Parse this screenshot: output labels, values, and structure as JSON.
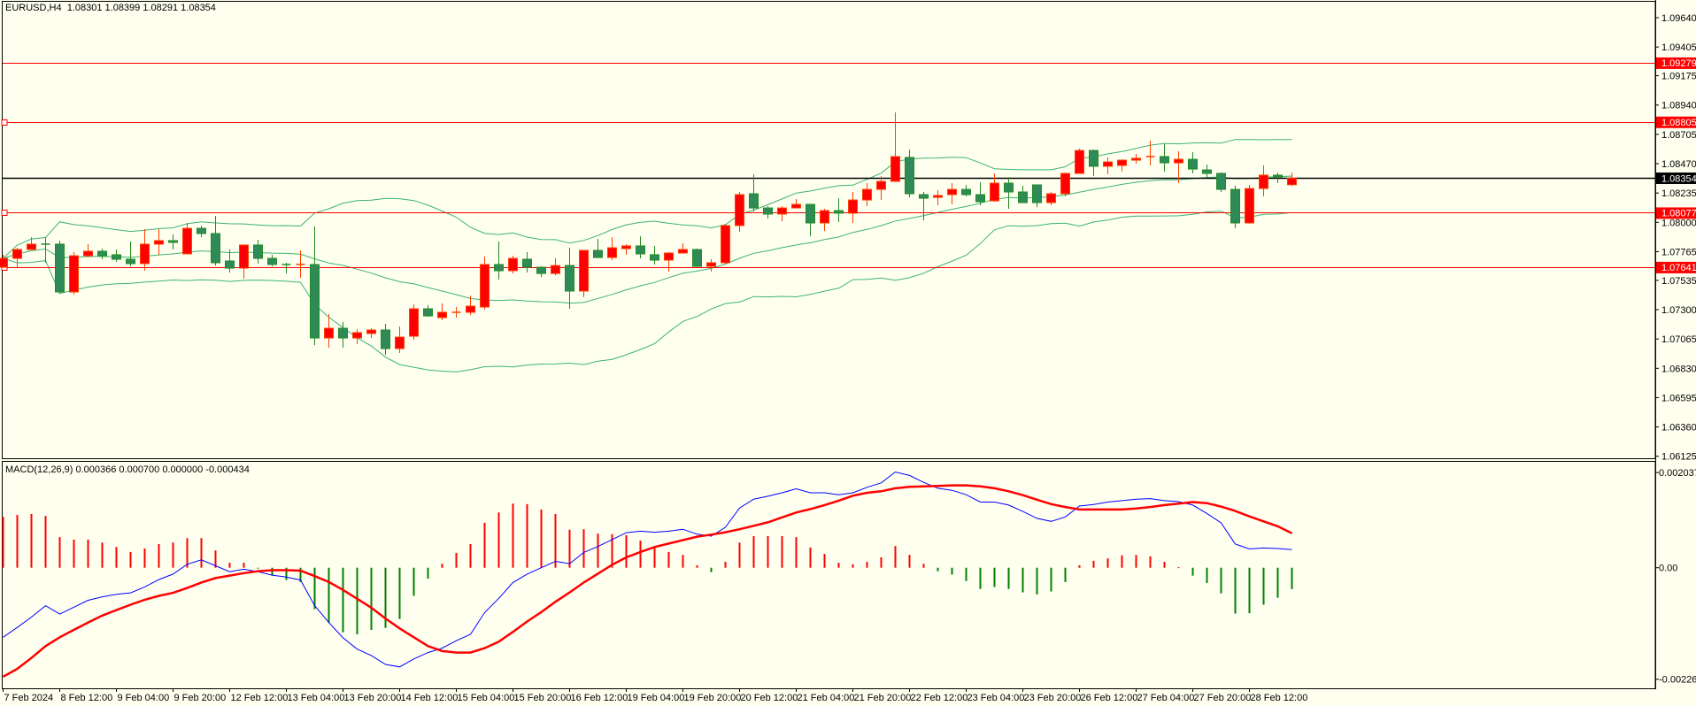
{
  "header": {
    "symbol": "EURUSD,H4",
    "ohlc": "1.08301 1.08399 1.08291 1.08354"
  },
  "macd_label": "MACD(12,26,9) 0.000366 0.000700 0.000000 -0.000434",
  "colors": {
    "background": "#fffff0",
    "bull_fill": "#ff0000",
    "bull_outline": "#ff4000",
    "bear_fill": "#2e8b57",
    "bear_outline": "#228b22",
    "bands": "#3cb371",
    "hline": "#ff0000",
    "current_price": "#000000",
    "macd_main": "#0000ff",
    "macd_signal": "#ff0000",
    "hist_up": "#ff0000",
    "hist_down": "#008000"
  },
  "time_axis": {
    "labels": [
      "7 Feb 2024",
      "8 Feb 12:00",
      "9 Feb 04:00",
      "9 Feb 20:00",
      "12 Feb 12:00",
      "13 Feb 04:00",
      "13 Feb 20:00",
      "14 Feb 12:00",
      "15 Feb 04:00",
      "15 Feb 20:00",
      "16 Feb 12:00",
      "19 Feb 04:00",
      "19 Feb 20:00",
      "20 Feb 12:00",
      "21 Feb 04:00",
      "21 Feb 20:00",
      "22 Feb 12:00",
      "23 Feb 04:00",
      "23 Feb 20:00",
      "26 Feb 12:00",
      "27 Feb 04:00",
      "27 Feb 20:00",
      "28 Feb 12:00"
    ]
  },
  "chart_data": [
    {
      "type": "candlestick",
      "symbol": "EURUSD",
      "timeframe": "H4",
      "ylim": [
        1.06125,
        1.0964
      ],
      "price_axis": {
        "ticks": [
          "1.09640",
          "1.09405",
          "1.09175",
          "1.08940",
          "1.08705",
          "1.08470",
          "1.08235",
          "1.08000",
          "1.07765",
          "1.07535",
          "1.07300",
          "1.07065",
          "1.06830",
          "1.06595",
          "1.06360",
          "1.06125"
        ]
      },
      "hlines": [
        {
          "label": "1.09279",
          "handle": false
        },
        {
          "label": "1.08805",
          "handle": true
        },
        {
          "label": "1.08077",
          "handle": true
        },
        {
          "label": "1.07641",
          "handle": true
        }
      ],
      "current_price": "1.08354",
      "indicator": "Bollinger Bands",
      "candles_ohlc": [
        [
          1.0764,
          1.0774,
          1.0764,
          1.07711
        ],
        [
          1.07711,
          1.07796,
          1.0764,
          1.07782
        ],
        [
          1.07782,
          1.07881,
          1.07782,
          1.07825
        ],
        [
          1.07825,
          1.07881,
          1.07676,
          1.07824
        ],
        [
          1.07825,
          1.07853,
          1.07428,
          1.07442
        ],
        [
          1.07442,
          1.07761,
          1.0742,
          1.07732
        ],
        [
          1.07732,
          1.07825,
          1.07718,
          1.07768
        ],
        [
          1.07768,
          1.07789,
          1.07704,
          1.07732
        ],
        [
          1.0774,
          1.07782,
          1.07683,
          1.07704
        ],
        [
          1.07704,
          1.07846,
          1.07647,
          1.07669
        ],
        [
          1.07669,
          1.07945,
          1.07612,
          1.07825
        ],
        [
          1.07825,
          1.07945,
          1.0774,
          1.07853
        ],
        [
          1.07853,
          1.07903,
          1.07782,
          1.07839
        ],
        [
          1.07747,
          1.07995,
          1.07747,
          1.07952
        ],
        [
          1.07952,
          1.07974,
          1.07881,
          1.0791
        ],
        [
          1.0791,
          1.08052,
          1.07654,
          1.07676
        ],
        [
          1.0769,
          1.07782,
          1.07598,
          1.07633
        ],
        [
          1.07633,
          1.07818,
          1.07548,
          1.07818
        ],
        [
          1.07818,
          1.0786,
          1.07669,
          1.07711
        ],
        [
          1.07711,
          1.0774,
          1.07647,
          1.07662
        ],
        [
          1.07662,
          1.07676,
          1.0759,
          1.0766
        ],
        [
          1.07662,
          1.07775,
          1.07555,
          1.07663
        ],
        [
          1.07662,
          1.07967,
          1.07016,
          1.07073
        ],
        [
          1.07073,
          1.07265,
          1.06995,
          1.07151
        ],
        [
          1.07151,
          1.07201,
          1.06995,
          1.07073
        ],
        [
          1.07073,
          1.07144,
          1.07023,
          1.07116
        ],
        [
          1.07109,
          1.07151,
          1.07073,
          1.07137
        ],
        [
          1.07137,
          1.07187,
          1.06938,
          1.06988
        ],
        [
          1.06988,
          1.07165,
          1.06953,
          1.0708
        ],
        [
          1.07087,
          1.07343,
          1.07059,
          1.07307
        ],
        [
          1.07307,
          1.07336,
          1.07243,
          1.0725
        ],
        [
          1.07236,
          1.0735,
          1.07215,
          1.07279
        ],
        [
          1.07279,
          1.07321,
          1.07236,
          1.07279
        ],
        [
          1.07279,
          1.07413,
          1.07257,
          1.07328
        ],
        [
          1.07321,
          1.07725,
          1.073,
          1.07662
        ],
        [
          1.07662,
          1.07846,
          1.07541,
          1.07612
        ],
        [
          1.07612,
          1.07732,
          1.0759,
          1.07711
        ],
        [
          1.07704,
          1.07761,
          1.07598,
          1.0764
        ],
        [
          1.0764,
          1.07647,
          1.07562,
          1.0759
        ],
        [
          1.0759,
          1.07711,
          1.07576,
          1.07654
        ],
        [
          1.07654,
          1.07796,
          1.07307,
          1.07449
        ],
        [
          1.07449,
          1.07775,
          1.07399,
          1.07775
        ],
        [
          1.07775,
          1.07867,
          1.07718,
          1.07718
        ],
        [
          1.07718,
          1.07881,
          1.07697,
          1.07796
        ],
        [
          1.07789,
          1.07825,
          1.0774,
          1.07811
        ],
        [
          1.07811,
          1.07888,
          1.07711,
          1.07747
        ],
        [
          1.0774,
          1.07811,
          1.07662,
          1.07697
        ],
        [
          1.07697,
          1.07761,
          1.07605,
          1.07754
        ],
        [
          1.07754,
          1.07832,
          1.07754,
          1.07782
        ],
        [
          1.07782,
          1.07789,
          1.0764,
          1.07647
        ],
        [
          1.07647,
          1.07704,
          1.07605,
          1.07676
        ],
        [
          1.07676,
          1.07988,
          1.07669,
          1.07974
        ],
        [
          1.07974,
          1.08243,
          1.07924,
          1.08222
        ],
        [
          1.08229,
          1.08385,
          1.08087,
          1.08115
        ],
        [
          1.08115,
          1.0813,
          1.0803,
          1.08066
        ],
        [
          1.08066,
          1.0813,
          1.08009,
          1.08115
        ],
        [
          1.08115,
          1.08186,
          1.08115,
          1.08144
        ],
        [
          1.08144,
          1.08144,
          1.07888,
          1.07995
        ],
        [
          1.07995,
          1.08108,
          1.07931,
          1.08094
        ],
        [
          1.08094,
          1.08193,
          1.08002,
          1.08073
        ],
        [
          1.08073,
          1.08243,
          1.07995,
          1.08179
        ],
        [
          1.08179,
          1.08314,
          1.0813,
          1.08264
        ],
        [
          1.08264,
          1.0837,
          1.08179,
          1.08328
        ],
        [
          1.08328,
          1.08881,
          1.08328,
          1.08527
        ],
        [
          1.0852,
          1.08583,
          1.082,
          1.08229
        ],
        [
          1.08222,
          1.08243,
          1.08016,
          1.08193
        ],
        [
          1.082,
          1.08257,
          1.08137,
          1.08215
        ],
        [
          1.08222,
          1.08314,
          1.08144,
          1.08264
        ],
        [
          1.08264,
          1.083,
          1.08208,
          1.08222
        ],
        [
          1.08222,
          1.08321,
          1.08137,
          1.08165
        ],
        [
          1.08172,
          1.08392,
          1.08165,
          1.08314
        ],
        [
          1.08314,
          1.08363,
          1.08108,
          1.08243
        ],
        [
          1.08243,
          1.08293,
          1.08158,
          1.08158
        ],
        [
          1.083,
          1.083,
          1.08122,
          1.08158
        ],
        [
          1.08158,
          1.08243,
          1.08137,
          1.08229
        ],
        [
          1.08229,
          1.08399,
          1.08208,
          1.08392
        ],
        [
          1.08392,
          1.08591,
          1.08392,
          1.08576
        ],
        [
          1.08576,
          1.08583,
          1.0837,
          1.08449
        ],
        [
          1.08449,
          1.0852,
          1.08385,
          1.08484
        ],
        [
          1.08456,
          1.08505,
          1.08406,
          1.08498
        ],
        [
          1.08498,
          1.08548,
          1.0847,
          1.08513
        ],
        [
          1.0852,
          1.08654,
          1.08456,
          1.08527
        ],
        [
          1.08527,
          1.08626,
          1.08406,
          1.08477
        ],
        [
          1.08477,
          1.08569,
          1.08314,
          1.08505
        ],
        [
          1.08505,
          1.08562,
          1.08392,
          1.08427
        ],
        [
          1.0842,
          1.08463,
          1.08363,
          1.08392
        ],
        [
          1.08392,
          1.08399,
          1.08243,
          1.08264
        ],
        [
          1.08264,
          1.08293,
          1.07952,
          1.07995
        ],
        [
          1.07995,
          1.083,
          1.07988,
          1.08271
        ],
        [
          1.08271,
          1.08456,
          1.08208,
          1.08378
        ],
        [
          1.08378,
          1.08399,
          1.08314,
          1.08363
        ],
        [
          1.08301,
          1.08399,
          1.08291,
          1.08354
        ]
      ]
    },
    {
      "type": "line",
      "title": "MACD(12,26,9)",
      "ylim": [
        -0.00226,
        0.002037
      ],
      "axis_labels": [
        "0.002037",
        "0.00",
        "-0.00226"
      ],
      "main": [
        -0.00141,
        -0.00121,
        -0.001,
        -0.00077,
        -0.00094,
        -0.0008,
        -0.00066,
        -0.00059,
        -0.00054,
        -0.00051,
        -0.00039,
        -0.00024,
        -0.00013,
        7e-05,
        0.00016,
        4e-05,
        -8e-05,
        -3e-05,
        -8e-05,
        -0.00015,
        -0.00019,
        -0.00025,
        -0.00077,
        -0.00111,
        -0.00142,
        -0.00165,
        -0.00178,
        -0.00196,
        -0.00201,
        -0.00185,
        -0.00172,
        -0.00163,
        -0.00148,
        -0.00135,
        -0.00091,
        -0.00062,
        -0.0003,
        -0.00013,
        0.0,
        0.00013,
        8e-05,
        0.00031,
        0.00043,
        0.00057,
        0.00071,
        0.00074,
        0.00072,
        0.00074,
        0.00078,
        0.00068,
        0.00064,
        0.00082,
        0.00121,
        0.00139,
        0.00145,
        0.00152,
        0.0016,
        0.00152,
        0.00152,
        0.00148,
        0.00152,
        0.00163,
        0.00172,
        0.00194,
        0.00187,
        0.00173,
        0.00161,
        0.00157,
        0.00148,
        0.00133,
        0.00133,
        0.00127,
        0.00114,
        0.001,
        0.00094,
        0.00103,
        0.00125,
        0.00128,
        0.00133,
        0.00136,
        0.00139,
        0.0014,
        0.00136,
        0.00134,
        0.00127,
        0.0011,
        0.00091,
        0.00048,
        0.00038,
        0.0004,
        0.00039,
        0.000366
      ],
      "signal": [
        -0.00221,
        -0.00205,
        -0.00183,
        -0.00159,
        -0.00141,
        -0.00126,
        -0.00111,
        -0.00097,
        -0.00086,
        -0.00075,
        -0.00065,
        -0.00057,
        -0.00051,
        -0.00041,
        -0.0003,
        -0.00021,
        -0.00016,
        -0.00011,
        -7e-05,
        -5e-05,
        -5e-05,
        -6e-05,
        -0.00017,
        -0.00029,
        -0.00045,
        -0.00063,
        -0.00081,
        -0.00103,
        -0.00123,
        -0.00141,
        -0.00159,
        -0.00169,
        -0.00172,
        -0.00172,
        -0.00163,
        -0.0015,
        -0.0013,
        -0.00109,
        -0.0009,
        -0.00069,
        -0.0005,
        -0.0003,
        -0.00012,
        6e-05,
        0.00021,
        0.00032,
        0.00042,
        0.00049,
        0.00056,
        0.00063,
        0.00067,
        0.00072,
        0.00078,
        0.00085,
        0.00092,
        0.00102,
        0.00112,
        0.00119,
        0.00127,
        0.00136,
        0.00146,
        0.00152,
        0.00155,
        0.00161,
        0.00164,
        0.00165,
        0.00166,
        0.00167,
        0.00167,
        0.00165,
        0.00161,
        0.00155,
        0.00147,
        0.00138,
        0.00129,
        0.00123,
        0.00118,
        0.00118,
        0.00118,
        0.00118,
        0.0012,
        0.00123,
        0.00127,
        0.0013,
        0.00133,
        0.00131,
        0.00124,
        0.00115,
        0.00104,
        0.00094,
        0.00084,
        0.0007
      ],
      "histogram": [
        0.00103,
        0.00107,
        0.00109,
        0.00105,
        0.00062,
        0.00057,
        0.00057,
        0.00051,
        0.00042,
        0.00032,
        0.00039,
        0.00048,
        0.00051,
        0.0006,
        0.0006,
        0.00035,
        0.0001,
        0.0001,
        -1e-05,
        -0.00016,
        -0.00025,
        -0.00029,
        -0.00084,
        -0.00112,
        -0.00131,
        -0.00135,
        -0.00126,
        -0.00122,
        -0.00104,
        -0.00057,
        -0.00022,
        8e-05,
        0.0003,
        0.00048,
        0.00091,
        0.00112,
        0.0013,
        0.00129,
        0.00118,
        0.00109,
        0.00077,
        0.00078,
        0.00069,
        0.00068,
        0.00066,
        0.00055,
        0.00042,
        0.00032,
        0.00026,
        5e-05,
        -9e-05,
        0.00012,
        0.00051,
        0.00064,
        0.00064,
        0.00064,
        0.00062,
        0.00041,
        0.00028,
        0.0001,
        7e-05,
        0.00012,
        0.00021,
        0.00044,
        0.00026,
        8e-05,
        -7e-05,
        -0.00014,
        -0.00027,
        -0.00043,
        -0.00039,
        -0.00043,
        -0.0005,
        -0.00054,
        -0.00048,
        -0.00029,
        5e-05,
        0.00014,
        0.00019,
        0.00025,
        0.00026,
        0.00023,
        0.00012,
        1e-05,
        -0.00016,
        -0.00031,
        -0.00052,
        -0.00093,
        -0.00092,
        -0.00075,
        -0.00061,
        -0.000434
      ]
    }
  ]
}
